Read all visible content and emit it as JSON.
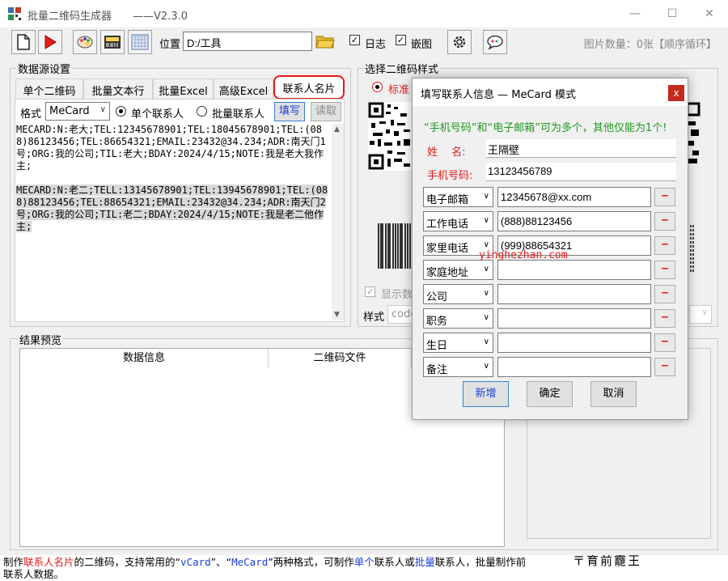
{
  "window": {
    "title": "批量二维码生成器",
    "version": "——V2.3.0",
    "minimize": "—",
    "maximize": "☐",
    "close": "✕"
  },
  "toolbar": {
    "location_label": "位置",
    "location_value": "D:/工具",
    "log_label": "日志",
    "embed_label": "嵌图",
    "image_count": "图片数量：0张【顺序循环】"
  },
  "datasource": {
    "title": "数据源设置",
    "tabs": [
      "单个二维码",
      "批量文本行",
      "批量Excel",
      "高级Excel",
      "联系人名片"
    ],
    "format_label": "格式",
    "format_value": "MeCard",
    "radio_single": "单个联系人",
    "radio_batch": "批量联系人",
    "fill_btn": "填写",
    "read_btn": "读取",
    "text_block1": "MECARD:N:老大;TEL:12345678901;TEL:18045678901;TEL:(088)86123456;TEL:86654321;EMAIL:23432@34.234;ADR:南天门1号;ORG:我的公司;TIL:老大;BDAY:2024/4/15;NOTE:我是老大我作主;",
    "text_block2": "MECARD:N:老二;TELL:13145678901;TEL:13945678901;TEL:(088)88123456;TEL:88654321;EMAIL:23432@34.234;ADR:南天门2号;ORG:我的公司;TIL:老二;BDAY:2024/4/15;NOTE:我是老二他作主;"
  },
  "qrstyle": {
    "title": "选择二维码样式",
    "std_label": "标准",
    "show_label": "显示数",
    "style_label": "样式",
    "style_value": "code"
  },
  "results": {
    "title": "结果预览",
    "col1": "数据信息",
    "col2": "二维码文件"
  },
  "dialog": {
    "title": "填写联系人信息 — MeCard 模式",
    "close": "x",
    "hint": "“手机号码”和“电子邮箱”可为多个，其他仅能为1个!",
    "name_label": "姓　 名:",
    "name_value": "王隔壁",
    "mobile_label": "手机号码:",
    "mobile_value": "13123456789",
    "rows": [
      {
        "field": "电子邮箱",
        "value": "12345678@xx.com"
      },
      {
        "field": "工作电话",
        "value": "(888)88123456"
      },
      {
        "field": "家里电话",
        "value": "(999)88654321"
      },
      {
        "field": "家庭地址",
        "value": ""
      },
      {
        "field": "公司",
        "value": ""
      },
      {
        "field": "职务",
        "value": ""
      },
      {
        "field": "生日",
        "value": ""
      },
      {
        "field": "备注",
        "value": ""
      }
    ],
    "minus": "−",
    "watermark": "yinghezhan.com",
    "btn_add": "新增",
    "btn_ok": "确定",
    "btn_cancel": "取消"
  },
  "status": {
    "p1": "制作",
    "p2": "联系人名片",
    "p3": "的二维码，支持常用的“",
    "p4": "vCard",
    "p5": "”、“",
    "p6": "MeCard",
    "p7": "”两种格式，可制作",
    "p8": "单个",
    "p9": "联系人或",
    "p10": "批量",
    "p11": "联系人，批量制作前",
    "p12": "联系人数据。",
    "deco": "〒育前龗王"
  }
}
